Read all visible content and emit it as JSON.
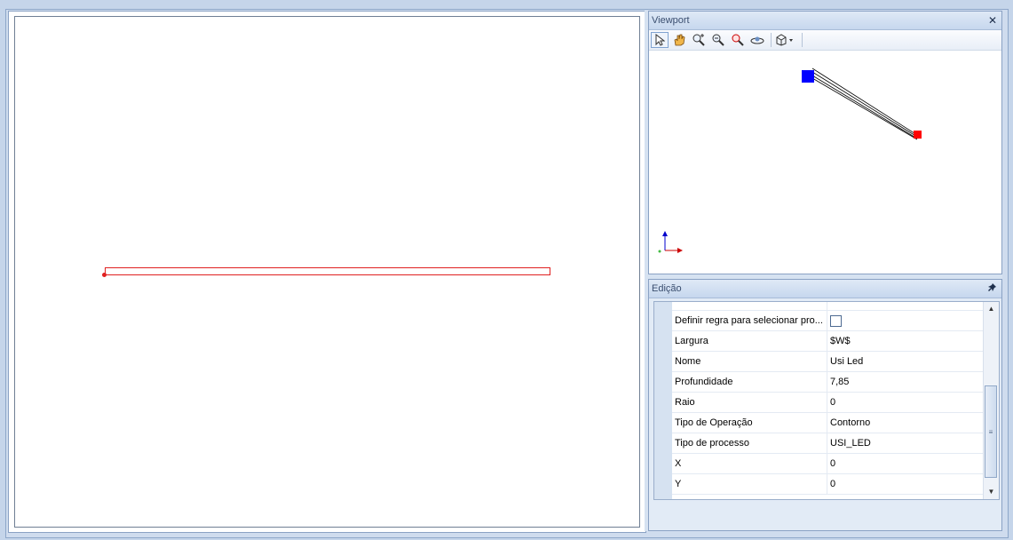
{
  "viewport_panel": {
    "title": "Viewport",
    "close_glyph": "✕",
    "toolbar_icons": [
      "select-arrow-icon",
      "pan-hand-icon",
      "zoom-in-icon",
      "zoom-window-icon",
      "zoom-extents-icon",
      "orbit-icon",
      "view-cube-icon"
    ]
  },
  "edit_panel": {
    "title": "Edição",
    "pin_glyph": "📌",
    "properties": [
      {
        "name": "Definir regra para selecionar pro...",
        "value": "",
        "type": "checkbox"
      },
      {
        "name": "Largura",
        "value": "$W$"
      },
      {
        "name": "Nome",
        "value": "Usi Led"
      },
      {
        "name": "Profundidade",
        "value": "7,85"
      },
      {
        "name": "Raio",
        "value": "0"
      },
      {
        "name": "Tipo de Operação",
        "value": "Contorno"
      },
      {
        "name": "Tipo de processo",
        "value": "USI_LED"
      },
      {
        "name": "X",
        "value": "0"
      },
      {
        "name": "Y",
        "value": "0"
      }
    ]
  },
  "colors": {
    "start_point": "#0000ff",
    "end_point": "#ff0000",
    "toolpath": "#e02020"
  }
}
